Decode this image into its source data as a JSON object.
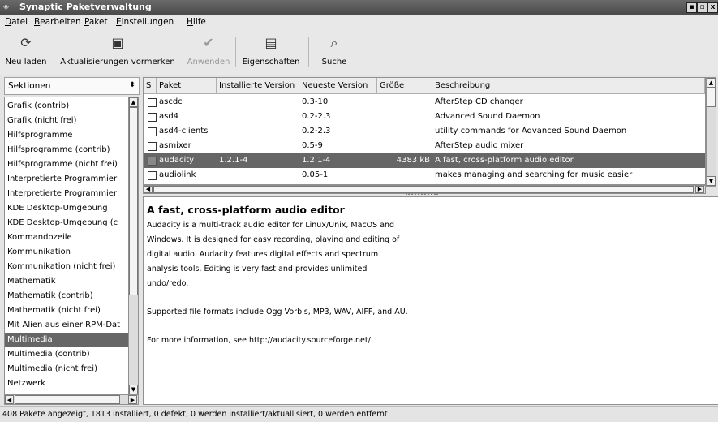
{
  "window": {
    "title": "Synaptic Paketverwaltung",
    "controls": [
      "▪",
      "▫",
      "x"
    ]
  },
  "menubar": [
    "Datei",
    "Bearbeiten",
    "Paket",
    "Einstellungen",
    "Hilfe"
  ],
  "toolbar": {
    "reload": "Neu laden",
    "mark_upgrades": "Aktualisierungen vormerken",
    "apply": "Anwenden",
    "properties": "Eigenschaften",
    "search": "Suche"
  },
  "sidebar": {
    "combo_label": "Sektionen",
    "items": [
      "Grafik (contrib)",
      "Grafik (nicht frei)",
      "Hilfsprogramme",
      "Hilfsprogramme (contrib)",
      "Hilfsprogramme (nicht frei)",
      "Interpretierte Programmier",
      "Interpretierte Programmier",
      "KDE Desktop-Umgebung",
      "KDE Desktop-Umgebung (c",
      "Kommandozeile",
      "Kommunikation",
      "Kommunikation (nicht frei)",
      "Mathematik",
      "Mathematik (contrib)",
      "Mathematik (nicht frei)",
      "Mit Alien aus einer RPM-Dat",
      "Multimedia",
      "Multimedia (contrib)",
      "Multimedia (nicht frei)",
      "Netzwerk"
    ],
    "selected": "Multimedia"
  },
  "table": {
    "columns": [
      "S",
      "Paket",
      "Installierte Version",
      "Neueste Version",
      "Größe",
      "Beschreibung"
    ],
    "rows": [
      {
        "name": "ascdc",
        "installed": "",
        "latest": "0.3-10",
        "size": "",
        "desc": "AfterStep CD changer"
      },
      {
        "name": "asd4",
        "installed": "",
        "latest": "0.2-2.3",
        "size": "",
        "desc": "Advanced Sound Daemon"
      },
      {
        "name": "asd4-clients",
        "installed": "",
        "latest": "0.2-2.3",
        "size": "",
        "desc": "utility commands for Advanced Sound Daemon"
      },
      {
        "name": "asmixer",
        "installed": "",
        "latest": "0.5-9",
        "size": "",
        "desc": "AfterStep audio mixer"
      },
      {
        "name": "audacity",
        "installed": "1.2.1-4",
        "latest": "1.2.1-4",
        "size": "4383 kB",
        "desc": "A fast, cross-platform audio editor"
      },
      {
        "name": "audiolink",
        "installed": "",
        "latest": "0.05-1",
        "size": "",
        "desc": "makes managing and searching for music easier"
      }
    ],
    "selected_row": "audacity"
  },
  "description": {
    "title": "A fast, cross-platform audio editor",
    "lines": [
      "Audacity is a multi-track audio editor for Linux/Unix, MacOS and",
      "Windows.  It is designed for easy recording, playing and editing of",
      "digital audio.  Audacity features digital effects and spectrum",
      "analysis tools.  Editing is very fast and provides unlimited",
      "undo/redo.",
      "",
      "Supported file formats include Ogg Vorbis, MP3, WAV, AIFF, and AU.",
      "",
      "For more information, see http://audacity.sourceforge.net/."
    ]
  },
  "status": "408 Pakete angezeigt, 1813 installiert, 0 defekt, 0 werden installiert/aktuallisiert, 0 werden entfernt",
  "colors": {
    "selection": "#666666",
    "titlebar": "#555555"
  }
}
